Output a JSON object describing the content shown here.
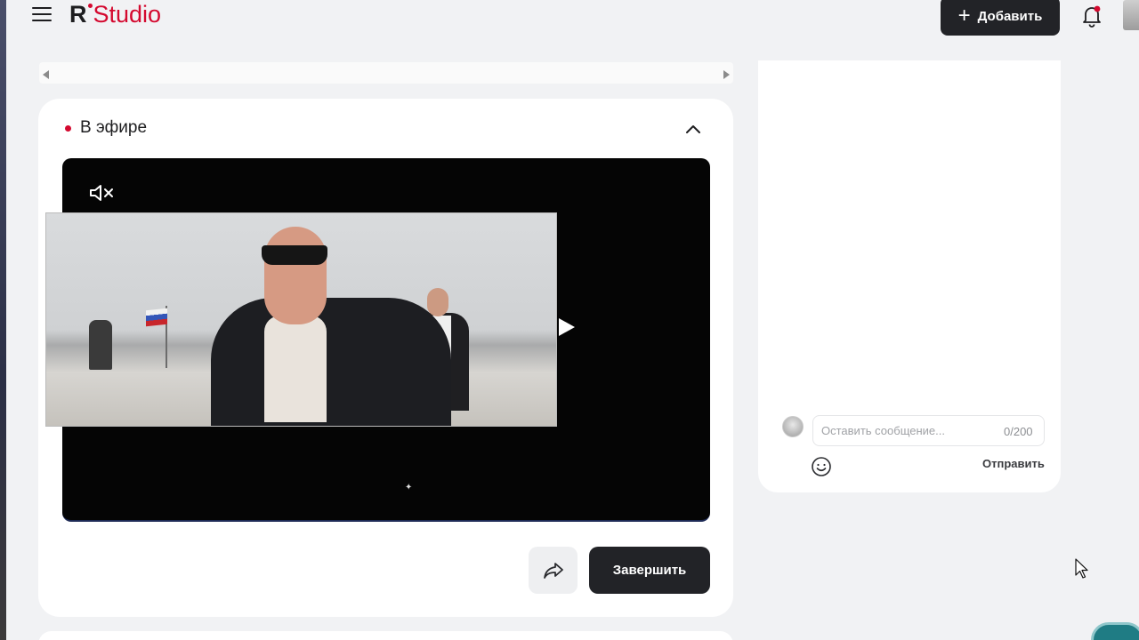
{
  "header": {
    "logo_r": "R",
    "logo_studio": "Studio",
    "add_button_label": "Добавить",
    "menu_icon": "hamburger-icon",
    "notification_icon": "bell-icon"
  },
  "live": {
    "title": "В эфире",
    "status_color": "#d4092f",
    "collapse_icon": "chevron-up-icon",
    "mute_icon": "speaker-muted-icon",
    "play_icon": "play-icon",
    "share_icon": "share-icon",
    "finish_button_label": "Завершить"
  },
  "chat": {
    "placeholder": "Оставить сообщение...",
    "counter": "0/200",
    "emoji_icon": "smiley-icon",
    "send_label": "Отправить"
  },
  "colors": {
    "accent": "#d4092f",
    "dark_button": "#222327",
    "background": "#f1f2f4"
  }
}
